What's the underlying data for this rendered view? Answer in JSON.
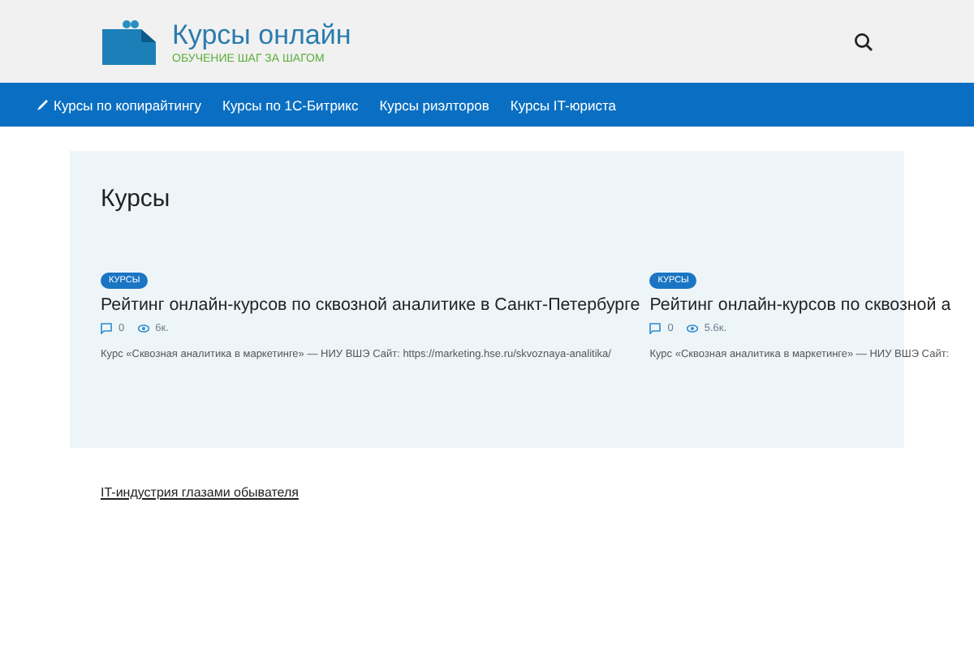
{
  "site": {
    "title": "Курсы онлайн",
    "tagline": "ОБУЧЕНИЕ ШАГ ЗА ШАГОМ"
  },
  "nav": {
    "items": [
      {
        "label": "Курсы по копирайтингу",
        "kind": "pen"
      },
      {
        "label": "Курсы по 1С-Битрикс",
        "kind": "plain"
      },
      {
        "label": "Курсы риэлторов",
        "kind": "plain"
      },
      {
        "label": "Курсы IT-юриста",
        "kind": "plain"
      }
    ]
  },
  "section": {
    "title": "Курсы",
    "posts": [
      {
        "tag": "КУРСЫ",
        "title": "Рейтинг онлайн-курсов по сквозной аналитике в Санкт-Петербурге",
        "comments": "0",
        "views": "6к.",
        "excerpt": "Курс «Сквозная аналитика в маркетинге» — НИУ ВШЭ Сайт: https://marketing.hse.ru/skvoznaya-analitika/"
      },
      {
        "tag": "КУРСЫ",
        "title": "Рейтинг онлайн-курсов по сквозной а",
        "comments": "0",
        "views": "5.6к.",
        "excerpt": "Курс «Сквозная аналитика в маркетинге» — НИУ ВШЭ Сайт:"
      }
    ]
  },
  "footer_link": "IT-индустрия глазами обывателя"
}
